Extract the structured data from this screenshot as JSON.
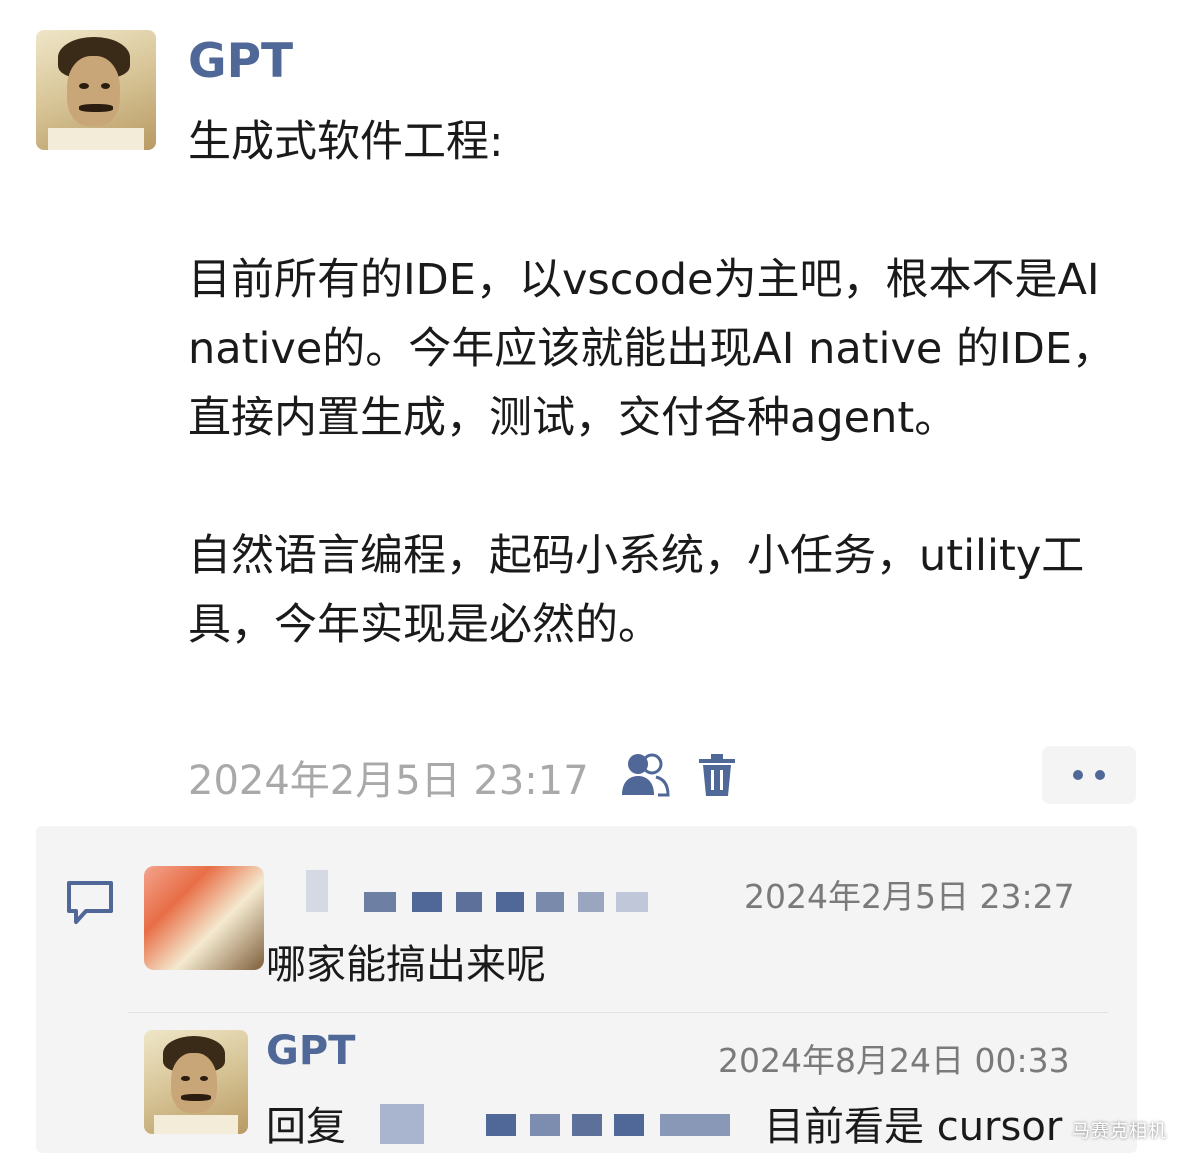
{
  "post": {
    "author": "GPT",
    "text": "生成式软件工程:\n\n目前所有的IDE，以vscode为主吧，根本不是AI native的。今年应该就能出现AI native 的IDE，直接内置生成，测试，交付各种agent。\n\n自然语言编程，起码小系统，小任务，utility工具，今年实现是必然的。",
    "timestamp": "2024年2月5日 23:17",
    "icons": {
      "friends": "friends-icon",
      "delete": "trash-icon",
      "more": "more-dots-icon"
    }
  },
  "comments": [
    {
      "author_hidden": true,
      "timestamp": "2024年2月5日 23:27",
      "text": "哪家能搞出来呢"
    },
    {
      "author": "GPT",
      "timestamp": "2024年8月24日 00:33",
      "reply_prefix": "回复",
      "text": "目前看是 cursor"
    }
  ],
  "colors": {
    "accent": "#4f6897",
    "muted": "#a9a9a9",
    "panel": "#f4f4f5"
  },
  "watermark": "马赛克相机"
}
